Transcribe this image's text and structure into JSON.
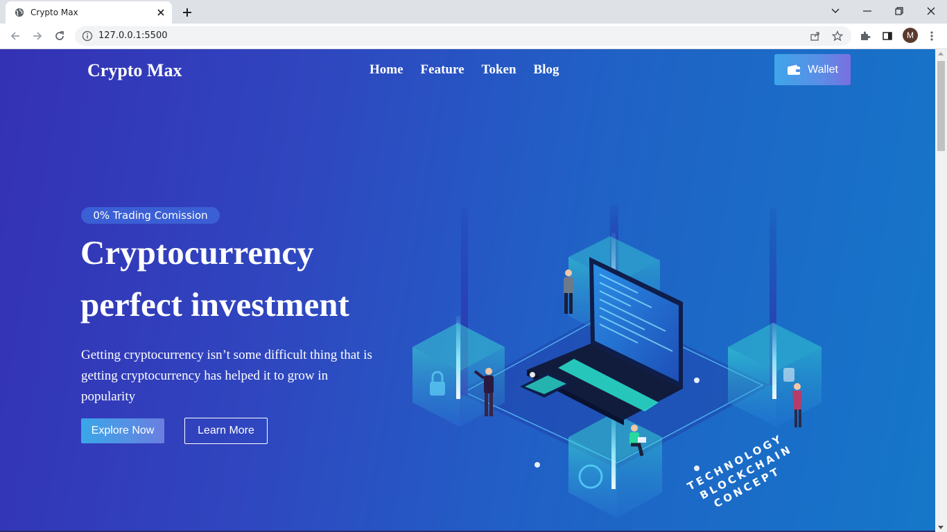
{
  "browser": {
    "tab_title": "Crypto Max",
    "url": "127.0.0.1:5500",
    "profile_initial": "M"
  },
  "site": {
    "brand": "Crypto Max",
    "nav": [
      "Home",
      "Feature",
      "Token",
      "Blog"
    ],
    "wallet_label": "Wallet"
  },
  "hero": {
    "badge": "0% Trading Comission",
    "title_line1": "Cryptocurrency",
    "title_line2": "perfect investment",
    "description": "Getting cryptocurrency isn’t some difficult thing that is getting cryptocurrency has helped it to grow in popularity",
    "explore_label": "Explore Now",
    "learn_label": "Learn More"
  },
  "illustration": {
    "caption_line1": "TECHNOLOGY",
    "caption_line2": "BLOCKCHAIN",
    "caption_line3": "CONCEPT"
  },
  "colors": {
    "accent_start": "#3fa5ea",
    "accent_end": "#7a6fe0",
    "hero_bg_left": "#3431b4",
    "hero_bg_right": "#1577c8"
  }
}
